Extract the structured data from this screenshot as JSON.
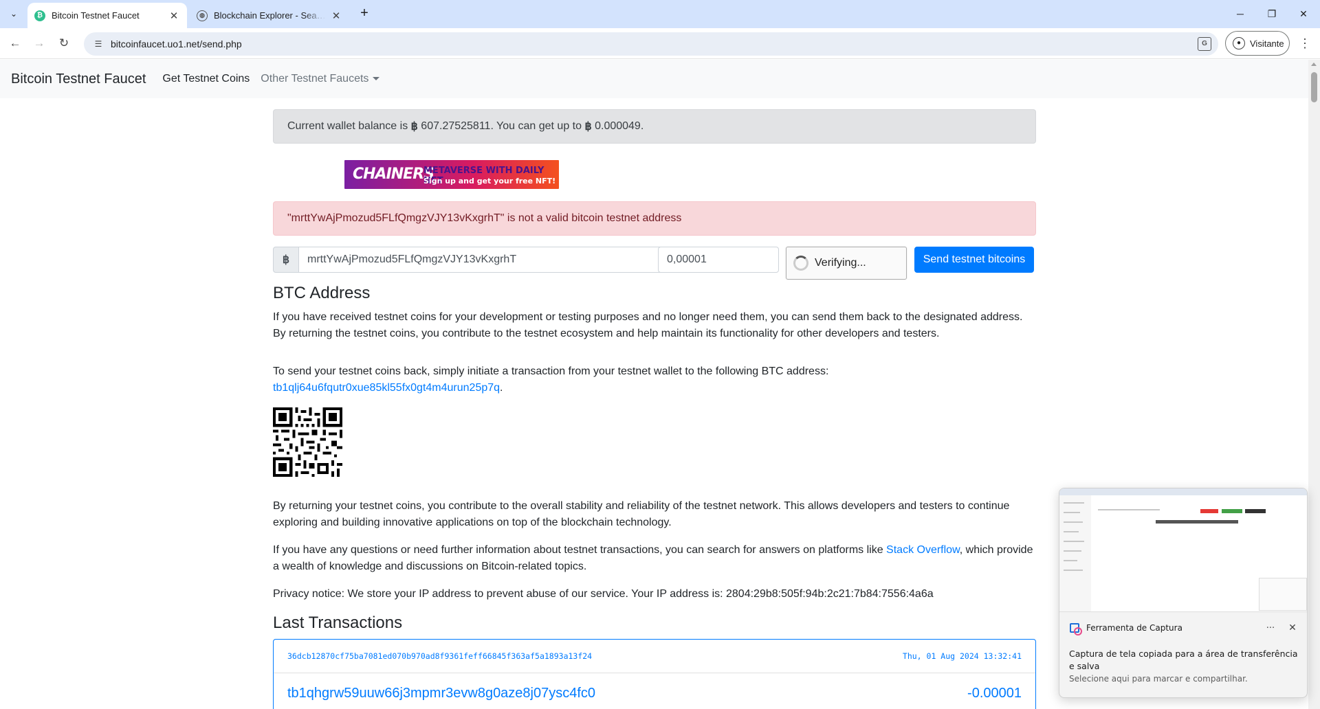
{
  "browser": {
    "tabs": [
      {
        "title": "Bitcoin Testnet Faucet",
        "favicon": "bitcoin-icon",
        "active": true
      },
      {
        "title": "Blockchain Explorer - Search the",
        "favicon": "globe-icon",
        "active": false
      }
    ],
    "url": "bitcoinfaucet.uo1.net/send.php",
    "profile_label": "Visitante"
  },
  "site": {
    "brand": "Bitcoin Testnet Faucet",
    "nav": {
      "get_coins": "Get Testnet Coins",
      "other_faucets": "Other Testnet Faucets"
    }
  },
  "balance_alert": {
    "prefix": "Current wallet balance is",
    "btc_symbol": "฿",
    "balance": "607.27525811",
    "middle": ". You can get up to",
    "max": "0.000049",
    "suffix": "."
  },
  "banner": {
    "logo": "CHAINERS",
    "line1": "METAVERSE WITH DAILY NFT",
    "line2": "Sign up and get your free NFT!"
  },
  "error_alert": "\"mrttYwAjPmozud5FLfQmgzVJY13vKxgrhT\" is not a valid bitcoin testnet address",
  "form": {
    "btc_symbol": "฿",
    "address_value": "mrttYwAjPmozud5FLfQmgzVJY13vKxgrhT",
    "amount_value": "0,00001",
    "captcha_status": "Verifying...",
    "send_button": "Send testnet bitcoins"
  },
  "btc_address_section": {
    "heading": "BTC Address",
    "para1": "If you have received testnet coins for your development or testing purposes and no longer need them, you can send them back to the designated address. By returning the testnet coins, you contribute to the testnet ecosystem and help maintain its functionality for other developers and testers.",
    "para2": "To send your testnet coins back, simply initiate a transaction from your testnet wallet to the following BTC address:",
    "address": "tb1qlj64u6fqutr0xue85kl55fx0gt4m4urun25p7q",
    "address_suffix": ".",
    "para3": "By returning your testnet coins, you contribute to the overall stability and reliability of the testnet network. This allows developers and testers to continue exploring and building innovative applications on top of the blockchain technology.",
    "para4_prefix": "If you have any questions or need further information about testnet transactions, you can search for answers on platforms like",
    "para4_link": "Stack Overflow",
    "para4_suffix": ", which provide a wealth of knowledge and discussions on Bitcoin-related topics.",
    "privacy": "Privacy notice: We store your IP address to prevent abuse of our service. Your IP address is: 2804:29b8:505f:94b:2c21:7b84:7556:4a6a"
  },
  "transactions": {
    "heading": "Last Transactions",
    "items": [
      {
        "txid": "36dcb12870cf75ba7081ed070b970ad8f9361feff66845f363af5a1893a13f24",
        "time": "Thu, 01 Aug 2024 13:32:41",
        "address": "tb1qhgrw59uuw66j3mpmr3evw8g0aze8j07ysc4fc0",
        "amount": "-0.00001"
      }
    ]
  },
  "toast": {
    "app_name": "Ferramenta de Captura",
    "more": "···",
    "close": "✕",
    "message": "Captura de tela copiada para a área de transferência e salva",
    "sub": "Selecione aqui para marcar e compartilhar."
  },
  "colors": {
    "link": "#007bff",
    "primary_button": "#007bff",
    "danger_bg": "#f8d7da",
    "secondary_bg": "#e2e3e5",
    "chrome_tabbar": "#d3e3fd"
  }
}
